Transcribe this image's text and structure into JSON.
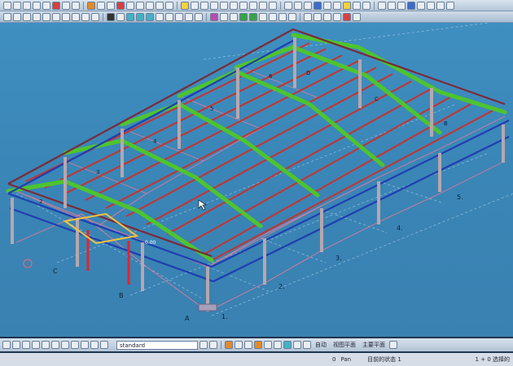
{
  "viewport": {
    "grid_letters": [
      "A",
      "B",
      "C"
    ],
    "grid_numbers": [
      "1.",
      "2.",
      "3.",
      "4.",
      "5."
    ],
    "beam_labels": [
      "2",
      "3",
      "4",
      "5",
      "6",
      "B",
      "C",
      "D"
    ],
    "elevation_label": "0.00",
    "colors": {
      "background": "#3a86b7",
      "eave_beam": "#1f3fb0",
      "rafter": "#c8322c",
      "main_frame": "#7a2b3a",
      "bracing": "#e07a9a",
      "purlin_highlight": "#4ec42e",
      "column": "#b7a7ad",
      "grid": "#8fb9d8"
    }
  },
  "commandbar": {
    "standard": "standard",
    "auto": "自动",
    "view_plane": "视图平面",
    "main_plane": "主要平面"
  },
  "statusbar": {
    "zero": "0",
    "pan": "Pan",
    "current_state": "目前的状态 1",
    "selection": "1 + 0 选择的"
  }
}
